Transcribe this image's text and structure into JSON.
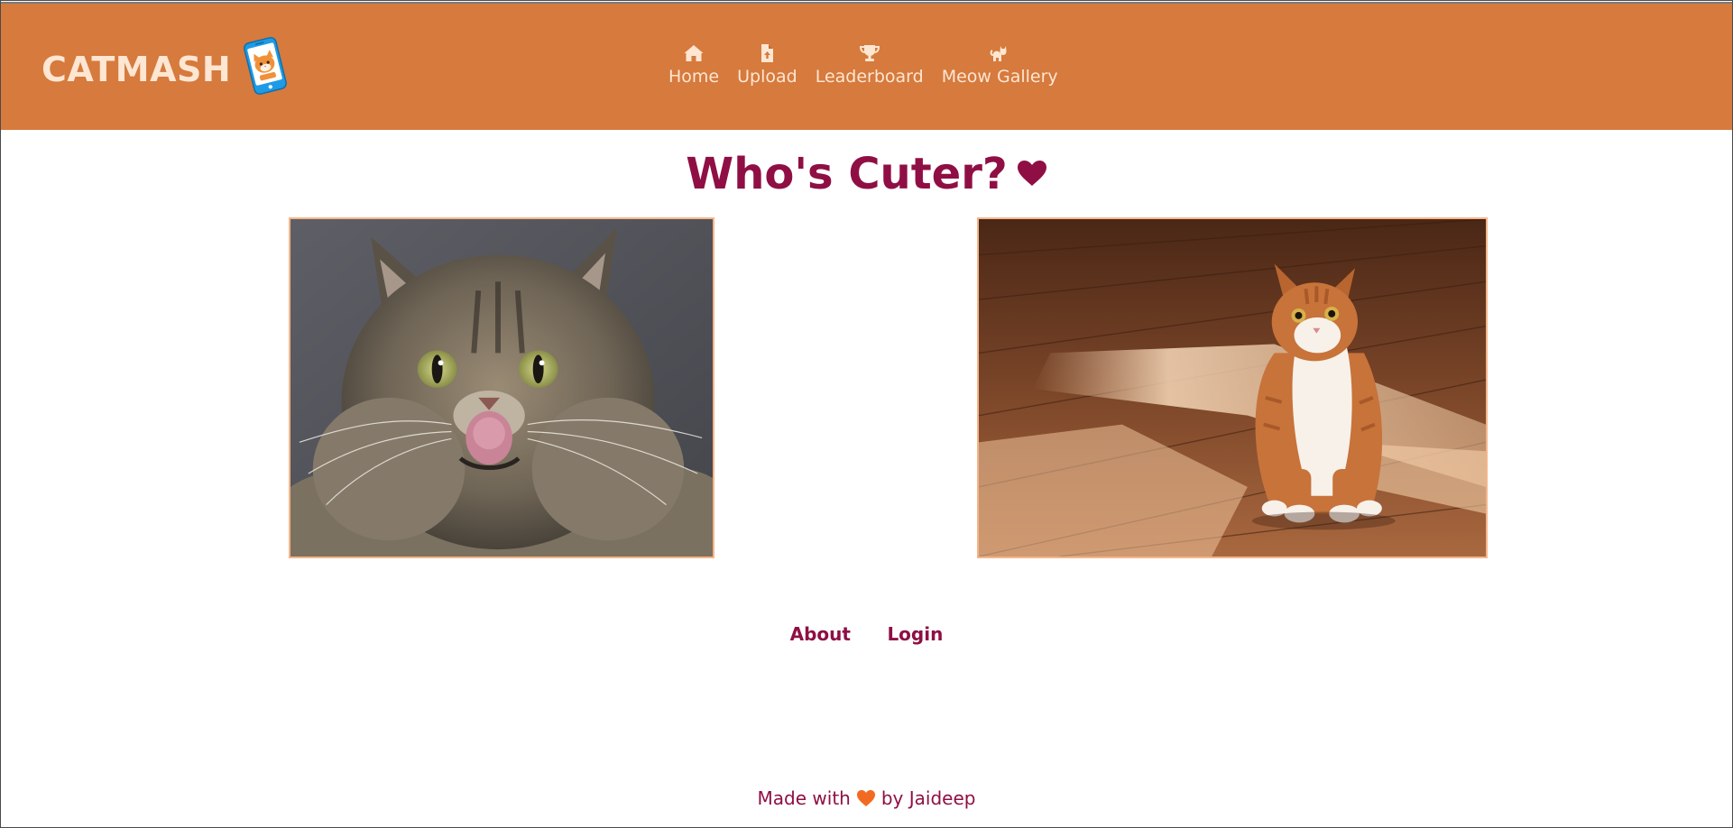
{
  "brand": {
    "name": "CATMASH",
    "logo_icon": "phone-cat-logo-icon"
  },
  "nav": {
    "items": [
      {
        "label": "Home",
        "icon": "home-icon"
      },
      {
        "label": "Upload",
        "icon": "file-upload-icon"
      },
      {
        "label": "Leaderboard",
        "icon": "trophy-icon"
      },
      {
        "label": "Meow Gallery",
        "icon": "cat-icon"
      }
    ]
  },
  "main": {
    "title": "Who's Cuter?",
    "title_icon": "heart-icon"
  },
  "footer": {
    "links": [
      "About",
      "Login"
    ],
    "made_with_prefix": "Made with",
    "made_with_suffix": "by Jaideep"
  },
  "colors": {
    "header_bg": "#d67a3d",
    "header_text": "#fde6d2",
    "accent": "#8f0f44",
    "photo_border": "#f4b58a",
    "footer_heart": "#f26a21"
  }
}
